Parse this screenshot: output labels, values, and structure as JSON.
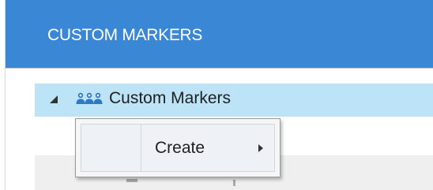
{
  "panel": {
    "title": "CUSTOM MARKERS",
    "header_color": "#3a87d6"
  },
  "tree": {
    "root": {
      "label": "Custom Markers",
      "icon": "people-group-icon",
      "expanded": true,
      "selected": true
    },
    "toggle_icon": "triangle-expanded-icon"
  },
  "context_menu": {
    "items": [
      {
        "label": "Create",
        "has_submenu": true,
        "submenu_icon": "chevron-right-icon"
      }
    ]
  },
  "colors": {
    "selection": "#bde3f7",
    "group_icon": "#2f78c4"
  }
}
